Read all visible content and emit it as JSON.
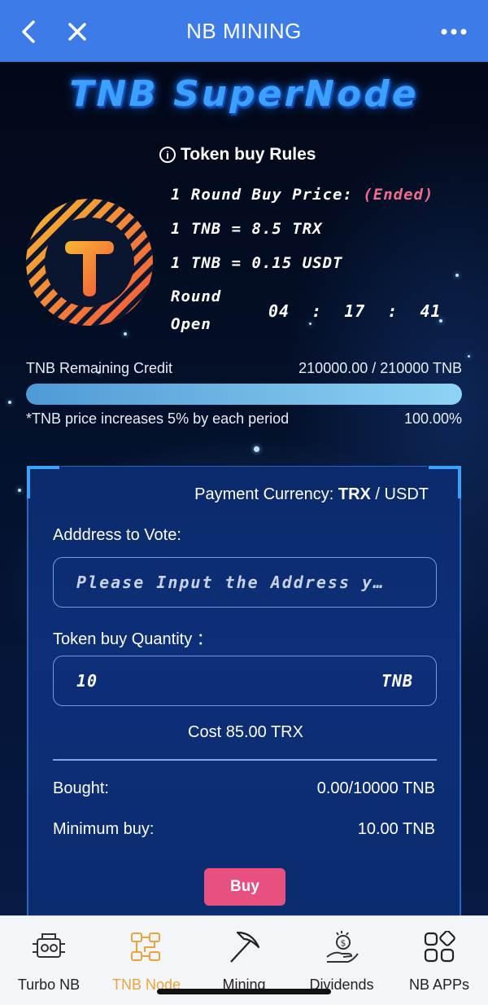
{
  "header": {
    "title": "NB MINING",
    "back_icon": "chevron-left-icon",
    "close_icon": "close-icon",
    "more_icon": "more-horizontal-icon"
  },
  "hero": {
    "title": "TNB SuperNode",
    "rules_label": "Token buy Rules",
    "round_price_label": "1 Round Buy Price:",
    "round_status": "(Ended)",
    "rate_trx": "1 TNB = 8.5 TRX",
    "rate_usdt": "1 TNB = 0.15 USDT",
    "round_open_line1": "Round",
    "round_open_line2": "Open",
    "timer": {
      "h": "04",
      "m": "17",
      "s": "41",
      "sep": ":"
    }
  },
  "credit": {
    "label": "TNB Remaining Credit",
    "value": "210000.00 / 210000 TNB",
    "note": "*TNB price increases 5% by each period",
    "percent_text": "100.00%",
    "progress": 1.0
  },
  "form": {
    "payment_label": "Payment Currency:",
    "currency_selected": "TRX",
    "currency_sep": "/",
    "currency_other": "USDT",
    "address_label": "Adddress to Vote:",
    "address_placeholder": "Please Input the Address y…",
    "quantity_label": "Token buy Quantity ：",
    "quantity_value": "10",
    "quantity_unit": "TNB",
    "cost": "Cost 85.00 TRX",
    "bought_label": "Bought:",
    "bought_value": "0.00/10000 TNB",
    "min_label": "Minimum buy:",
    "min_value": "10.00 TNB",
    "buy_button": "Buy"
  },
  "tabs": [
    {
      "label": "Turbo NB",
      "icon": "engine-icon"
    },
    {
      "label": "TNB Node",
      "icon": "node-network-icon",
      "active": true
    },
    {
      "label": "Mining",
      "icon": "pickaxe-icon"
    },
    {
      "label": "Dividends",
      "icon": "dividend-hand-coin-icon"
    },
    {
      "label": "NB APPs",
      "icon": "apps-grid-icon"
    }
  ],
  "colors": {
    "header_bg": "#3c7be8",
    "accent_active_tab": "#eca43a",
    "buy_button": "#e8507f",
    "ended_text": "#f06a8c",
    "title_glow": "#3da0ff"
  }
}
